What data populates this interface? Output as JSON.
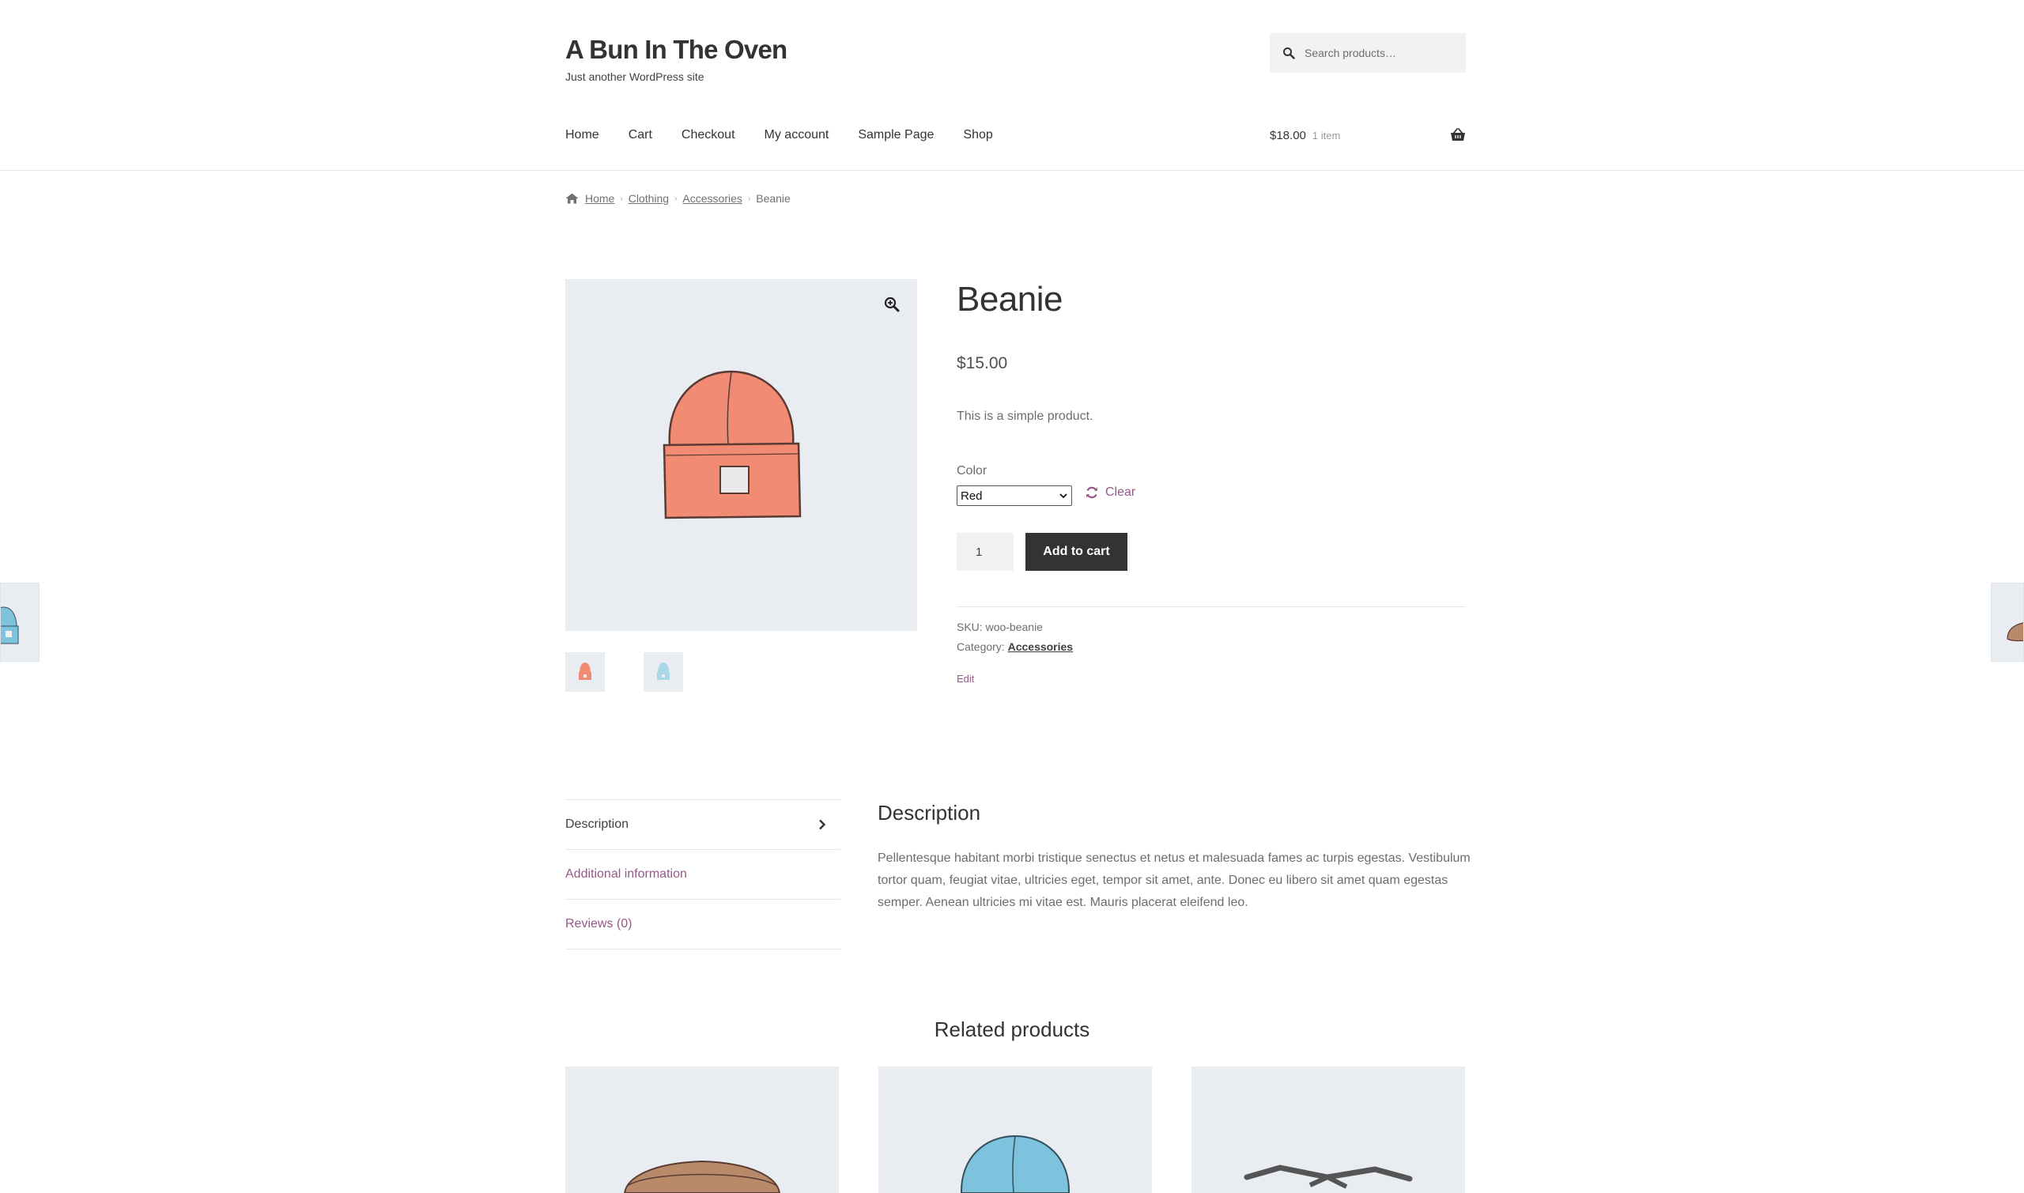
{
  "site": {
    "title": "A Bun In The Oven",
    "tagline": "Just another WordPress site"
  },
  "search": {
    "placeholder": "Search products…",
    "icon": "search-icon"
  },
  "nav": {
    "items": [
      {
        "label": "Home"
      },
      {
        "label": "Cart"
      },
      {
        "label": "Checkout"
      },
      {
        "label": "My account"
      },
      {
        "label": "Sample Page"
      },
      {
        "label": "Shop"
      }
    ]
  },
  "minicart": {
    "amount": "$18.00",
    "count": "1 item",
    "icon": "basket-icon"
  },
  "breadcrumb": {
    "home": "Home",
    "items": [
      "Clothing",
      "Accessories"
    ],
    "current": "Beanie"
  },
  "product": {
    "title": "Beanie",
    "price": "$15.00",
    "short_description": "This is a simple product.",
    "color_label": "Color",
    "color_selected": "Red",
    "clear_label": "Clear",
    "quantity": "1",
    "add_to_cart": "Add to cart",
    "sku_label": "SKU:",
    "sku": "woo-beanie",
    "category_label": "Category:",
    "category": "Accessories",
    "edit": "Edit"
  },
  "tabs": {
    "items": [
      {
        "label": "Description",
        "active": true
      },
      {
        "label": "Additional information",
        "active": false
      },
      {
        "label": "Reviews (0)",
        "active": false
      }
    ]
  },
  "description": {
    "heading": "Description",
    "body": "Pellentesque habitant morbi tristique senectus et netus et malesuada fames ac turpis egestas. Vestibulum tortor quam, feugiat vitae, ultricies eget, tempor sit amet, ante. Donec eu libero sit amet quam egestas semper. Aenean ultricies mi vitae est. Mauris placerat eleifend leo."
  },
  "related": {
    "heading": "Related products"
  },
  "colors": {
    "accent": "#96588a",
    "button": "#333333",
    "image_bg": "#e9edf1",
    "beanie_red": "#f28b74",
    "beanie_blue": "#7ec3de"
  }
}
